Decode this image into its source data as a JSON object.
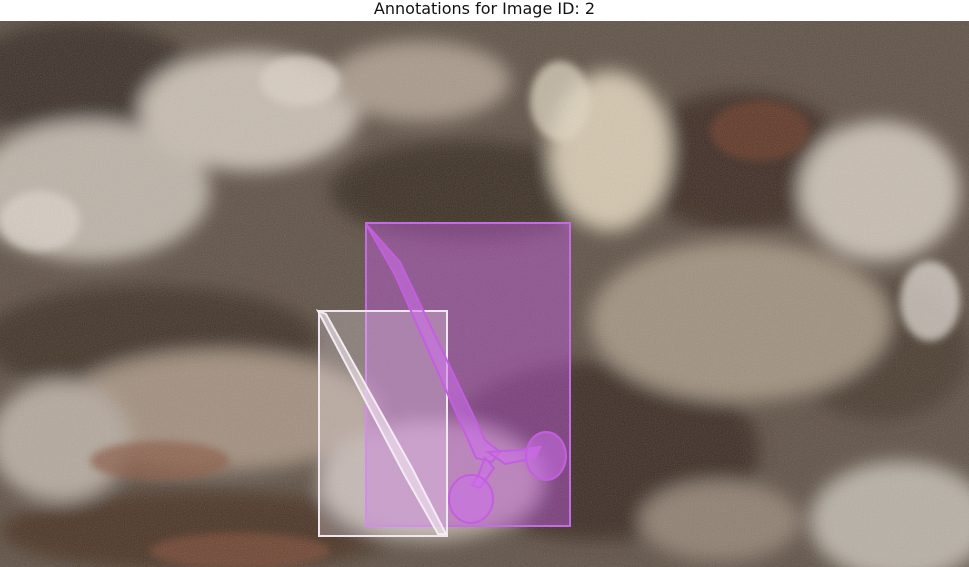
{
  "figure": {
    "title": "Annotations for Image ID: 2"
  },
  "annotations": [
    {
      "object": "scissors-like instrument",
      "color": "#c45ee0"
    },
    {
      "object": "thin rod instrument",
      "color": "#f2e6f2"
    }
  ],
  "palette": {
    "rock_dark": "#3e3027",
    "rock_mid": "#7b6c5d",
    "rock_light": "#cfc5b7",
    "rock_warm": "#8a6a52"
  }
}
